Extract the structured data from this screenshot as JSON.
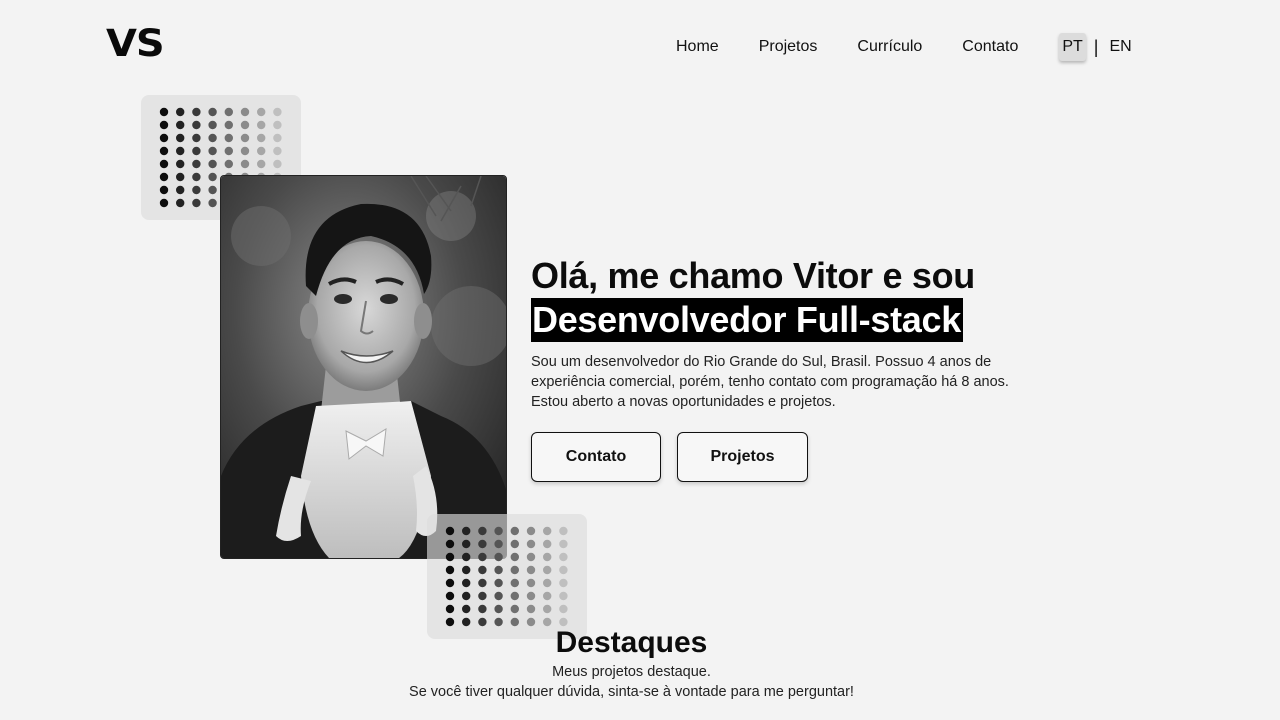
{
  "header": {
    "logo": "VS",
    "nav": {
      "home": "Home",
      "projects": "Projetos",
      "resume": "Currículo",
      "contact": "Contato"
    },
    "lang": {
      "pt": "PT",
      "separator": "|",
      "en": "EN",
      "active": "PT"
    }
  },
  "hero": {
    "greeting": "Olá, me chamo Vitor e sou",
    "role": "Desenvolvedor Full-stack",
    "description_lines": [
      "Sou um desenvolvedor do Rio Grande do Sul, Brasil. Possuo 4 anos de",
      "experiência comercial, porém, tenho contato com programação há 8 anos.",
      "Estou aberto a novas oportunidades e projetos."
    ],
    "buttons": {
      "contact": "Contato",
      "projects": "Projetos"
    }
  },
  "highlights": {
    "title": "Destaques",
    "subtitle_lines": [
      "Meus projetos destaque.",
      "Se você tiver qualquer dúvida, sinta-se à vontade para me perguntar!"
    ]
  },
  "colors": {
    "background": "#f3f3f3",
    "text": "#111111",
    "highlight_bg": "#000000",
    "highlight_text": "#ffffff"
  },
  "icons": {
    "decor": "dot-grid-pattern"
  }
}
